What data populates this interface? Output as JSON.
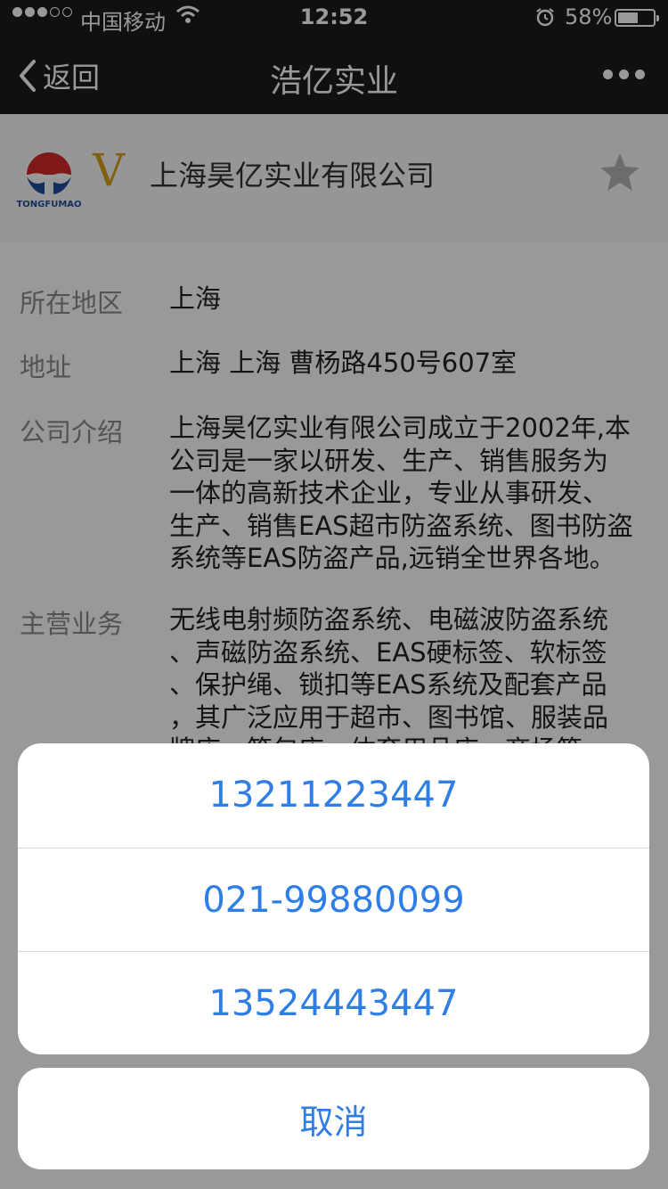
{
  "status_bar": {
    "carrier": "中国移动",
    "time": "12:52",
    "battery_percent": "58%",
    "battery_level": 0.58
  },
  "nav": {
    "back_label": "返回",
    "title": "浩亿实业"
  },
  "company": {
    "logo_text": "TONGFUMAO",
    "verified_mark": "V",
    "name": "上海昊亿实业有限公司"
  },
  "info": {
    "region": {
      "label": "所在地区",
      "value": "上海"
    },
    "address": {
      "label": "地址",
      "value": "上海 上海 曹杨路450号607室"
    },
    "intro": {
      "label": "公司介绍",
      "lines": [
        "上海昊亿实业有限公司成立于2002年,本",
        "公司是一家以研发、生产、销售服务为",
        "一体的高新技术企业，专业从事研发、",
        "生产、销售EAS超市防盗系统、图书防盗",
        "系统等EAS防盗产品,远销全世界各地。"
      ]
    },
    "business": {
      "label": "主营业务",
      "lines": [
        "无线电射频防盗系统、电磁波防盗系统",
        "、声磁防盗系统、EAS硬标签、软标签",
        "、保护绳、锁扣等EAS系统及配套产品",
        "，其广泛应用于超市、图书馆、服装品",
        "牌店、箱包店、体育用品店、商场等"
      ]
    }
  },
  "action_sheet": {
    "options": [
      "13211223447",
      "021-99880099",
      "13524443447"
    ],
    "cancel_label": "取消"
  },
  "colors": {
    "accent": "#2f7ee6",
    "bar_bg": "#1b1b1b",
    "verified_gold": "#d4a21d"
  }
}
